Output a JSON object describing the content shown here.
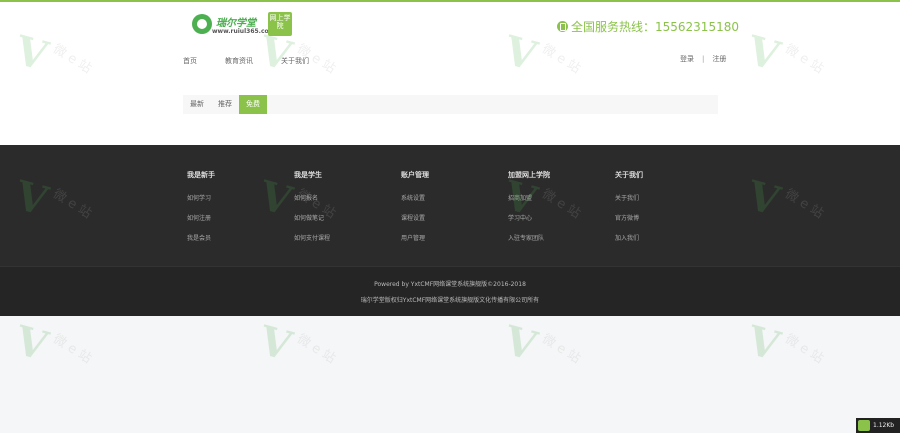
{
  "brand": {
    "name": "瑞尔学堂",
    "url": "www.ruiul365.com",
    "badge": "网上学院",
    "accent": "#8bc34a"
  },
  "hotline": {
    "icon": "phone-icon",
    "text": "全国服务热线：15562315180"
  },
  "nav": {
    "items": [
      "首页",
      "教育资讯",
      "关于我们"
    ]
  },
  "auth": {
    "login": "登录",
    "separator": "|",
    "register": "注册"
  },
  "filter": {
    "tabs": [
      "最新",
      "推荐",
      "免费"
    ],
    "active": 2
  },
  "footer": {
    "columns": [
      {
        "title": "我是新手",
        "links": [
          "如何学习",
          "如何注册",
          "我是会员"
        ]
      },
      {
        "title": "我是学生",
        "links": [
          "如何报名",
          "如何做笔记",
          "如何支付课程"
        ]
      },
      {
        "title": "账户管理",
        "links": [
          "系统设置",
          "课程设置",
          "用户管理"
        ]
      },
      {
        "title": "加盟网上学院",
        "links": [
          "招商加盟",
          "学习中心",
          "入驻专家团队"
        ]
      },
      {
        "title": "关于我们",
        "links": [
          "关于我们",
          "官方微博",
          "加入我们"
        ]
      }
    ]
  },
  "copyright": {
    "line1": "Powered by YxtCMF网络课堂系统旗舰版©2016-2018",
    "line2": "瑞尔学堂版权归YxtCMF网络课堂系统旗舰版文化传播有限公司所有"
  },
  "watermark": {
    "text": "微 e 站",
    "url": "www.vioee.com"
  },
  "speed_badge": {
    "text": "1.12Kb"
  }
}
